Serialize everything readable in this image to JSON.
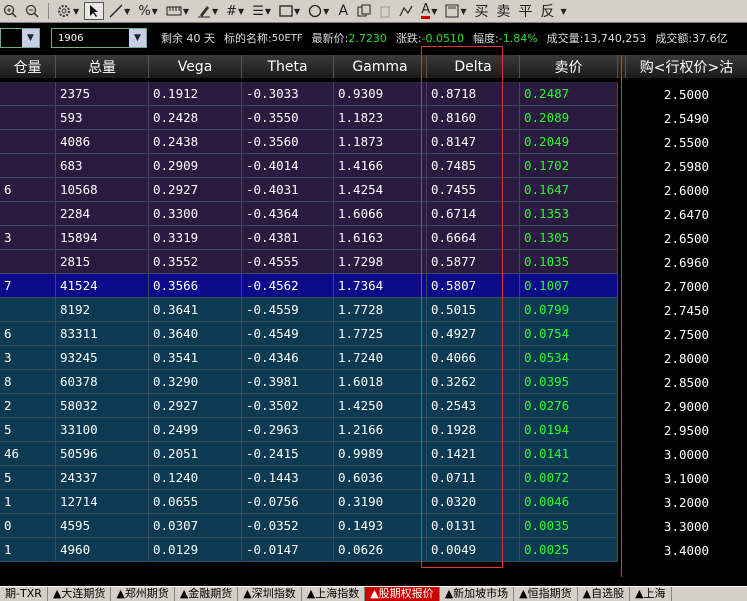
{
  "toolbar": {
    "icons": [
      "zoom-in-icon",
      "zoom-out-icon",
      "gear-icon",
      "pointer-icon",
      "line-icon",
      "percent-icon",
      "ruler-icon",
      "pen-icon",
      "hash-icon",
      "list-icon",
      "grid-icon",
      "rectangle-icon",
      "circle-icon",
      "text-icon",
      "copy-icon",
      "trash-icon",
      "draw-icon",
      "color-icon",
      "save-icon"
    ],
    "chinese_buttons": [
      "买",
      "卖",
      "平",
      "反"
    ]
  },
  "info": {
    "combo_left_value": "",
    "combo_right_value": "1906",
    "remaining": "剩余 40 天",
    "underlying_label": "标的名称:",
    "underlying_value": "50ETF",
    "last_label": "最新价:",
    "last_value": "2.7230",
    "change_label": "涨跌:",
    "change_value": "-0.0510",
    "pct_label": "幅度:",
    "pct_value": "-1.84%",
    "vol_label": "成交量:",
    "vol_value": "13,740,253",
    "amount_label": "成交额:",
    "amount_value": "37.6亿"
  },
  "table": {
    "headers": [
      "仓量",
      "总量",
      "Vega",
      "Theta",
      "Gamma",
      "Delta",
      "卖价",
      "",
      "购<行权价>沽"
    ],
    "rows": [
      {
        "oi": "",
        "total": "2375",
        "vega": "0.1912",
        "theta": "-0.3033",
        "gamma": "0.9309",
        "delta": "0.8718",
        "ask": "0.2487",
        "strike": "2.5000",
        "style": "purple"
      },
      {
        "oi": "",
        "total": "593",
        "vega": "0.2428",
        "theta": "-0.3550",
        "gamma": "1.1823",
        "delta": "0.8160",
        "ask": "0.2089",
        "strike": "2.5490",
        "style": "purple"
      },
      {
        "oi": "",
        "total": "4086",
        "vega": "0.2438",
        "theta": "-0.3560",
        "gamma": "1.1873",
        "delta": "0.8147",
        "ask": "0.2049",
        "strike": "2.5500",
        "style": "purple"
      },
      {
        "oi": "",
        "total": "683",
        "vega": "0.2909",
        "theta": "-0.4014",
        "gamma": "1.4166",
        "delta": "0.7485",
        "ask": "0.1702",
        "strike": "2.5980",
        "style": "purple"
      },
      {
        "oi": "6",
        "total": "10568",
        "vega": "0.2927",
        "theta": "-0.4031",
        "gamma": "1.4254",
        "delta": "0.7455",
        "ask": "0.1647",
        "strike": "2.6000",
        "style": "purple"
      },
      {
        "oi": "",
        "total": "2284",
        "vega": "0.3300",
        "theta": "-0.4364",
        "gamma": "1.6066",
        "delta": "0.6714",
        "ask": "0.1353",
        "strike": "2.6470",
        "style": "purple"
      },
      {
        "oi": "3",
        "total": "15894",
        "vega": "0.3319",
        "theta": "-0.4381",
        "gamma": "1.6163",
        "delta": "0.6664",
        "ask": "0.1305",
        "strike": "2.6500",
        "style": "purple"
      },
      {
        "oi": "",
        "total": "2815",
        "vega": "0.3552",
        "theta": "-0.4555",
        "gamma": "1.7298",
        "delta": "0.5877",
        "ask": "0.1035",
        "strike": "2.6960",
        "style": "purple"
      },
      {
        "oi": "7",
        "total": "41524",
        "vega": "0.3566",
        "theta": "-0.4562",
        "gamma": "1.7364",
        "delta": "0.5807",
        "ask": "0.1007",
        "strike": "2.7000",
        "style": "sel"
      },
      {
        "oi": "",
        "total": "8192",
        "vega": "0.3641",
        "theta": "-0.4559",
        "gamma": "1.7728",
        "delta": "0.5015",
        "ask": "0.0799",
        "strike": "2.7450",
        "style": "teal"
      },
      {
        "oi": "6",
        "total": "83311",
        "vega": "0.3640",
        "theta": "-0.4549",
        "gamma": "1.7725",
        "delta": "0.4927",
        "ask": "0.0754",
        "strike": "2.7500",
        "style": "teal"
      },
      {
        "oi": "3",
        "total": "93245",
        "vega": "0.3541",
        "theta": "-0.4346",
        "gamma": "1.7240",
        "delta": "0.4066",
        "ask": "0.0534",
        "strike": "2.8000",
        "style": "teal"
      },
      {
        "oi": "8",
        "total": "60378",
        "vega": "0.3290",
        "theta": "-0.3981",
        "gamma": "1.6018",
        "delta": "0.3262",
        "ask": "0.0395",
        "strike": "2.8500",
        "style": "teal"
      },
      {
        "oi": "2",
        "total": "58032",
        "vega": "0.2927",
        "theta": "-0.3502",
        "gamma": "1.4250",
        "delta": "0.2543",
        "ask": "0.0276",
        "strike": "2.9000",
        "style": "teal"
      },
      {
        "oi": "5",
        "total": "33100",
        "vega": "0.2499",
        "theta": "-0.2963",
        "gamma": "1.2166",
        "delta": "0.1928",
        "ask": "0.0194",
        "strike": "2.9500",
        "style": "teal"
      },
      {
        "oi": "46",
        "total": "50596",
        "vega": "0.2051",
        "theta": "-0.2415",
        "gamma": "0.9989",
        "delta": "0.1421",
        "ask": "0.0141",
        "strike": "3.0000",
        "style": "teal"
      },
      {
        "oi": "5",
        "total": "24337",
        "vega": "0.1240",
        "theta": "-0.1443",
        "gamma": "0.6036",
        "delta": "0.0711",
        "ask": "0.0072",
        "strike": "3.1000",
        "style": "teal"
      },
      {
        "oi": "1",
        "total": "12714",
        "vega": "0.0655",
        "theta": "-0.0756",
        "gamma": "0.3190",
        "delta": "0.0320",
        "ask": "0.0046",
        "strike": "3.2000",
        "style": "teal"
      },
      {
        "oi": "0",
        "total": "4595",
        "vega": "0.0307",
        "theta": "-0.0352",
        "gamma": "0.1493",
        "delta": "0.0131",
        "ask": "0.0035",
        "strike": "3.3000",
        "style": "teal"
      },
      {
        "oi": "1",
        "total": "4960",
        "vega": "0.0129",
        "theta": "-0.0147",
        "gamma": "0.0626",
        "delta": "0.0049",
        "ask": "0.0025",
        "strike": "3.4000",
        "style": "teal"
      }
    ]
  },
  "tabs": [
    "期-TXR",
    "▲大连期货",
    "▲郑州期货",
    "▲金融期货",
    "▲深圳指数",
    "▲上海指数",
    "▲股期权报价",
    "▲新加坡市场",
    "▲恒指期货",
    "▲自选股",
    "▲上海"
  ],
  "active_tab_index": 6,
  "colors": {
    "ask_green": "#22ff22",
    "highlight_red": "#d33333",
    "selected_row": "#0a0a8a"
  }
}
